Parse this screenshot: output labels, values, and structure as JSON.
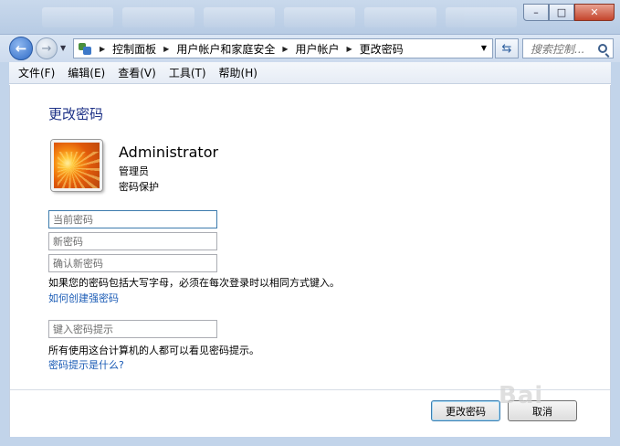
{
  "window": {
    "controls": {
      "minimize": "–",
      "maximize": "□",
      "close": "✕"
    }
  },
  "nav": {
    "back_icon": "back-arrow-icon",
    "forward_icon": "forward-arrow-icon"
  },
  "address_bar": {
    "crumbs": [
      "控制面板",
      "用户帐户和家庭安全",
      "用户帐户",
      "更改密码"
    ]
  },
  "search": {
    "placeholder": "搜索控制..."
  },
  "menu": {
    "items": [
      "文件(F)",
      "编辑(E)",
      "查看(V)",
      "工具(T)",
      "帮助(H)"
    ]
  },
  "page": {
    "title": "更改密码",
    "user": {
      "name": "Administrator",
      "role": "管理员",
      "protection": "密码保护"
    },
    "fields": {
      "current_password": {
        "placeholder": "当前密码",
        "value": ""
      },
      "new_password": {
        "placeholder": "新密码",
        "value": ""
      },
      "confirm_password": {
        "placeholder": "确认新密码",
        "value": ""
      },
      "hint": {
        "placeholder": "键入密码提示",
        "value": ""
      }
    },
    "case_note": "如果您的密码包括大写字母，必须在每次登录时以相同方式键入。",
    "strong_link": "如何创建强密码",
    "hint_note": "所有使用这台计算机的人都可以看见密码提示。",
    "hint_link": "密码提示是什么?"
  },
  "buttons": {
    "change": "更改密码",
    "cancel": "取消"
  },
  "watermark": "Bai"
}
